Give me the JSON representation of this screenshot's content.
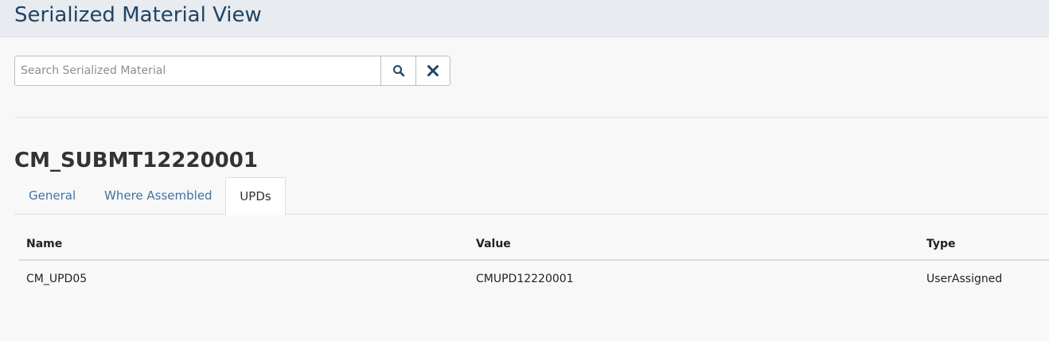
{
  "header": {
    "title": "Serialized Material View"
  },
  "search": {
    "placeholder": "Search Serialized Material",
    "value": "",
    "search_icon": "search-icon",
    "clear_icon": "close-icon"
  },
  "record": {
    "title": "CM_SUBMT12220001"
  },
  "tabs": [
    {
      "label": "General",
      "active": false
    },
    {
      "label": "Where Assembled",
      "active": false
    },
    {
      "label": "UPDs",
      "active": true
    }
  ],
  "table": {
    "columns": [
      "Name",
      "Value",
      "Type"
    ],
    "rows": [
      [
        "CM_UPD05",
        "CMUPD12220001",
        "UserAssigned"
      ]
    ]
  },
  "colors": {
    "title": "#1f4466",
    "tab_link": "#3f73a3",
    "header_bg": "#e8ebef",
    "icon": "#1f4466"
  }
}
